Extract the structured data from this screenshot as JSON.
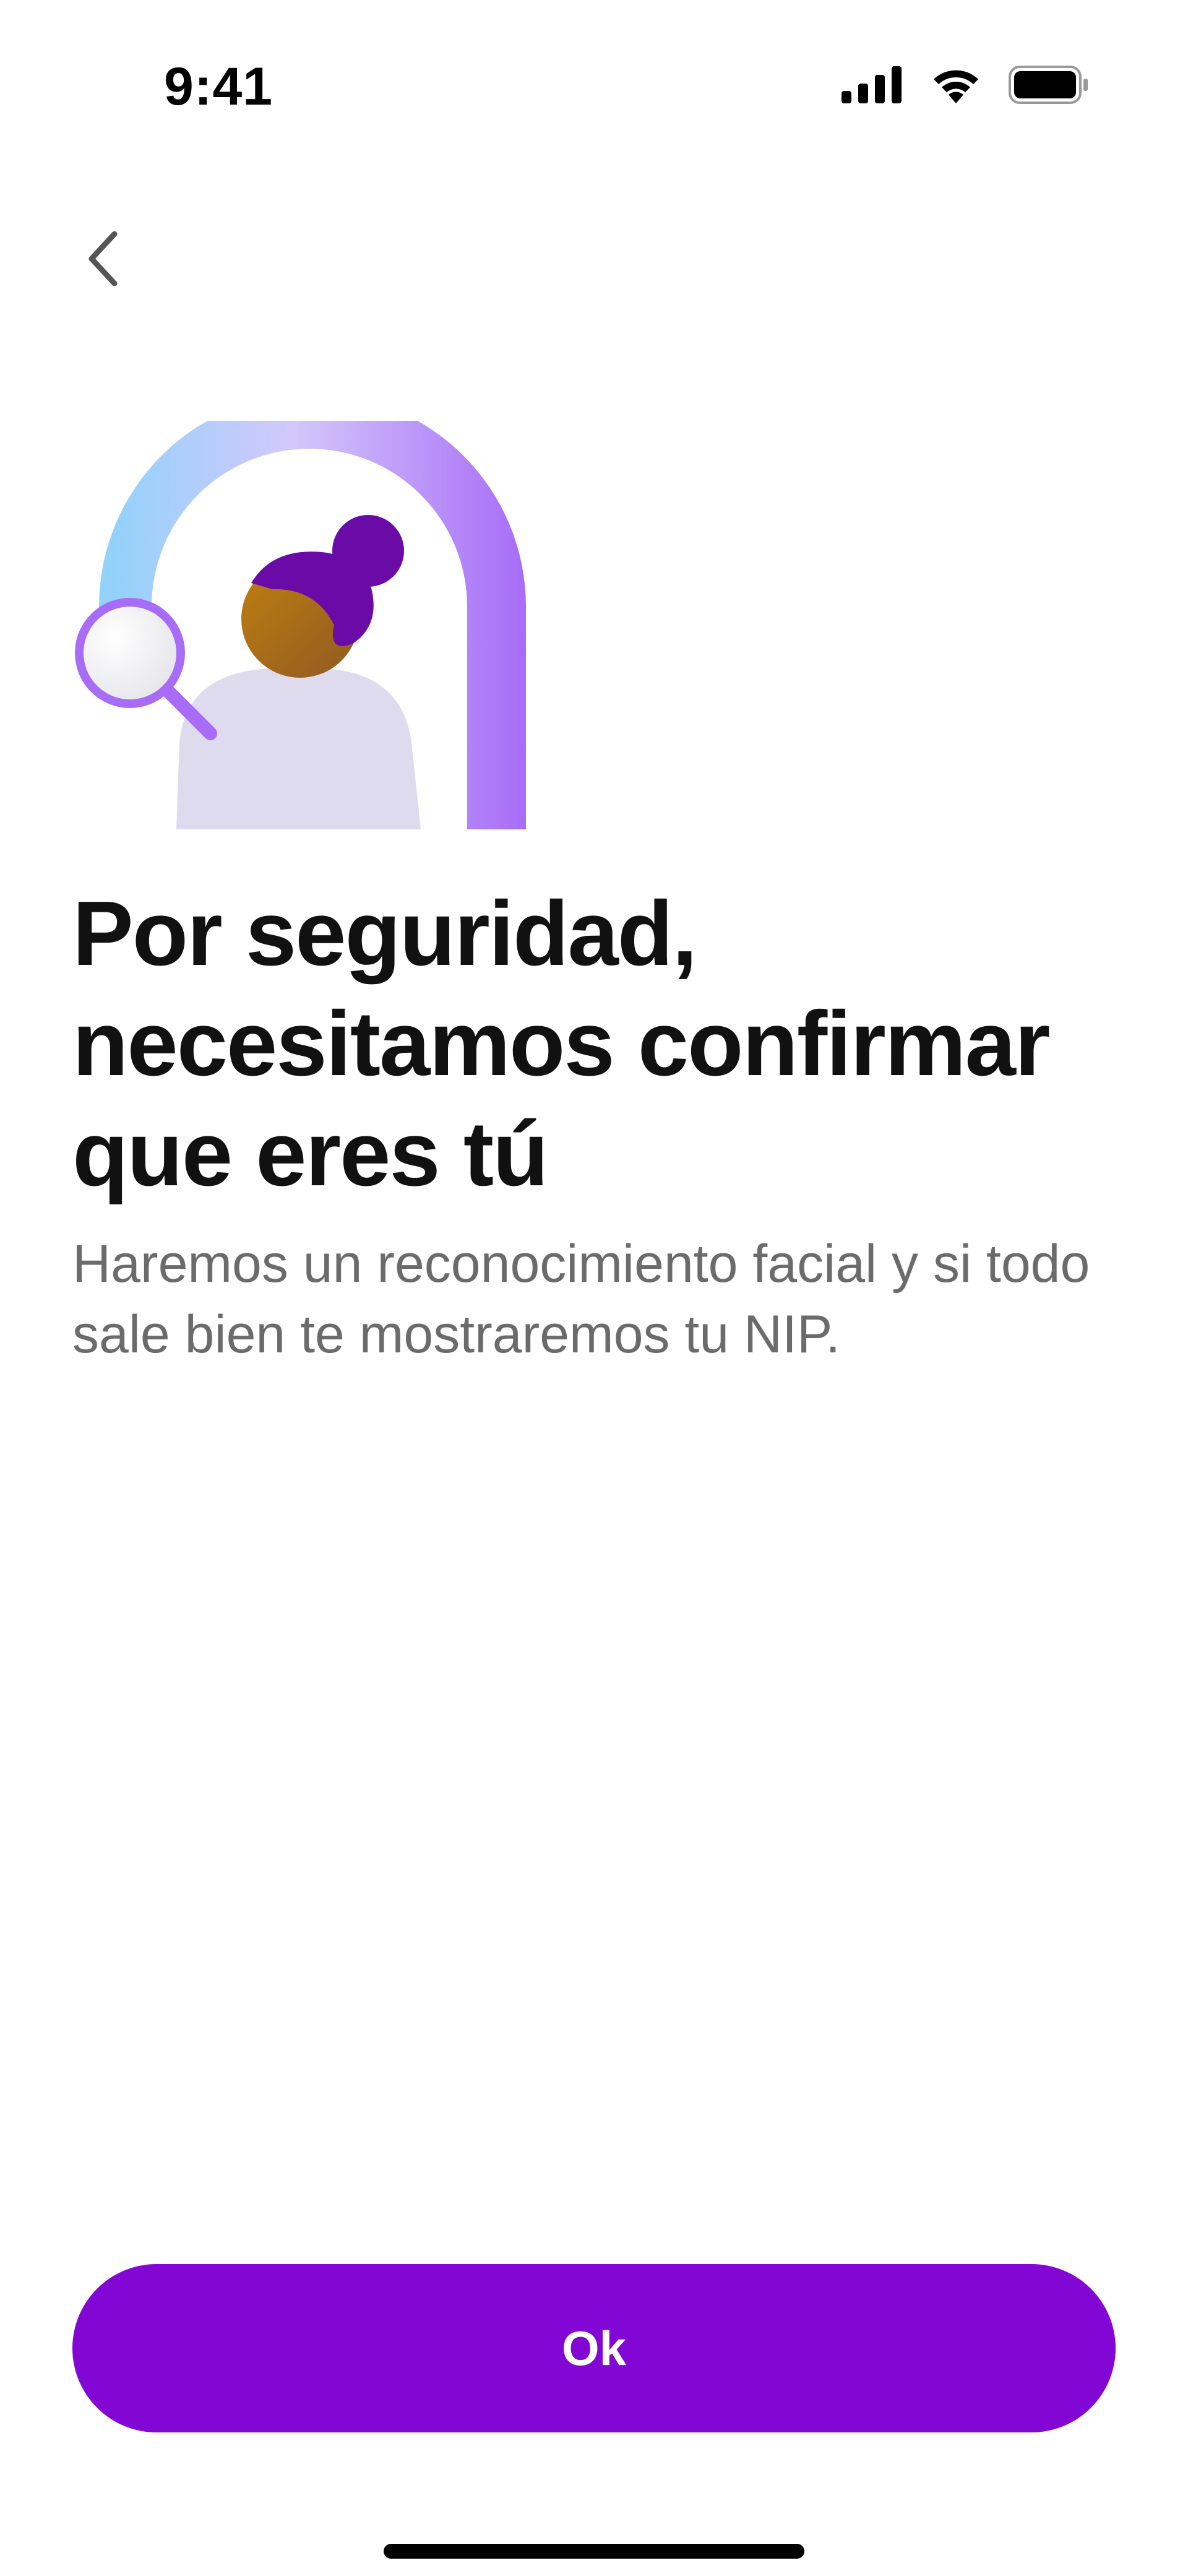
{
  "status_bar": {
    "time": "9:41",
    "icons": [
      "cellular-signal-icon",
      "wifi-icon",
      "battery-icon"
    ]
  },
  "navigation": {
    "back_icon": "chevron-left-icon"
  },
  "illustration": {
    "description_icon": "face-recognition-illustration",
    "colors": {
      "arch_start": "#8fd3fb",
      "arch_end": "#a86cf7",
      "hair": "#6a0ba8",
      "skin": "#b57a12",
      "body": "#dedbee",
      "magnifier_ring": "#a86cf7"
    }
  },
  "content": {
    "headline": "Por seguridad, necesitamos confirmar que eres tú",
    "subtitle": "Haremos un reconocimiento facial y si todo sale bien te mostraremos tu NIP."
  },
  "actions": {
    "ok_label": "Ok"
  },
  "theme": {
    "primary": "#8207d4",
    "text": "#111111",
    "muted_text": "#6b6b6b",
    "background": "#ffffff"
  }
}
